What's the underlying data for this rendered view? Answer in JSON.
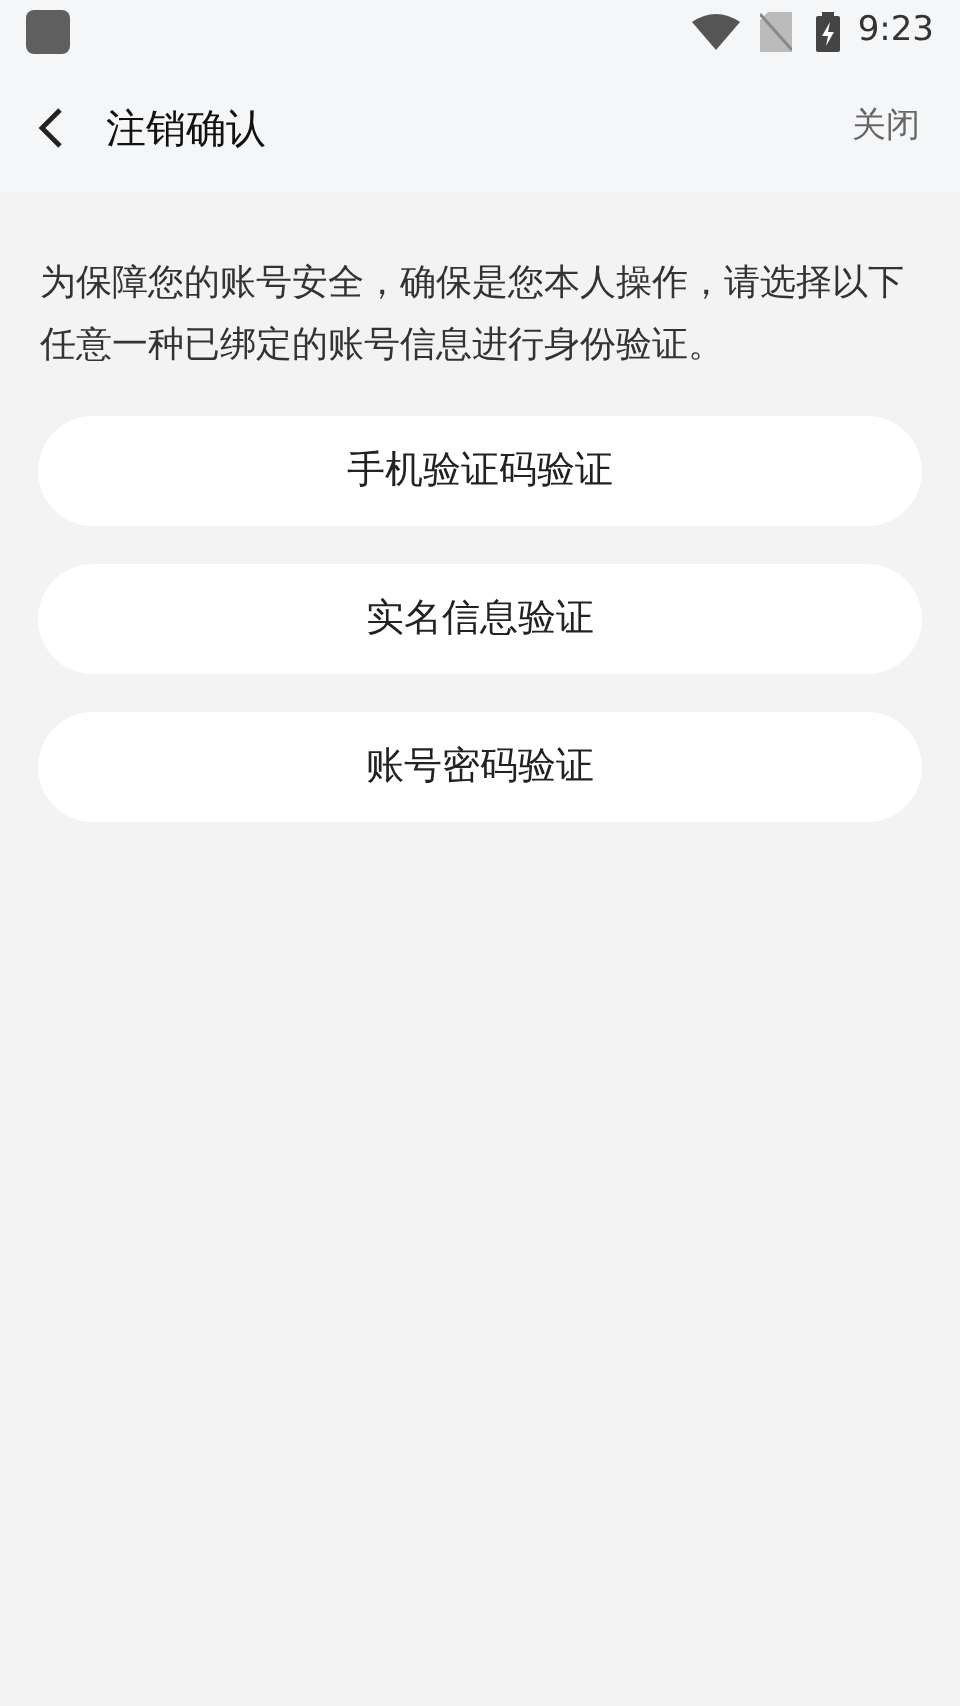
{
  "status_bar": {
    "time": "9:23"
  },
  "header": {
    "title": "注销确认",
    "close": "关闭"
  },
  "description": "为保障您的账号安全，确保是您本人操作，请选择以下任意一种已绑定的账号信息进行身份验证。",
  "options": [
    {
      "label": "手机验证码验证"
    },
    {
      "label": "实名信息验证"
    },
    {
      "label": "账号密码验证"
    }
  ]
}
